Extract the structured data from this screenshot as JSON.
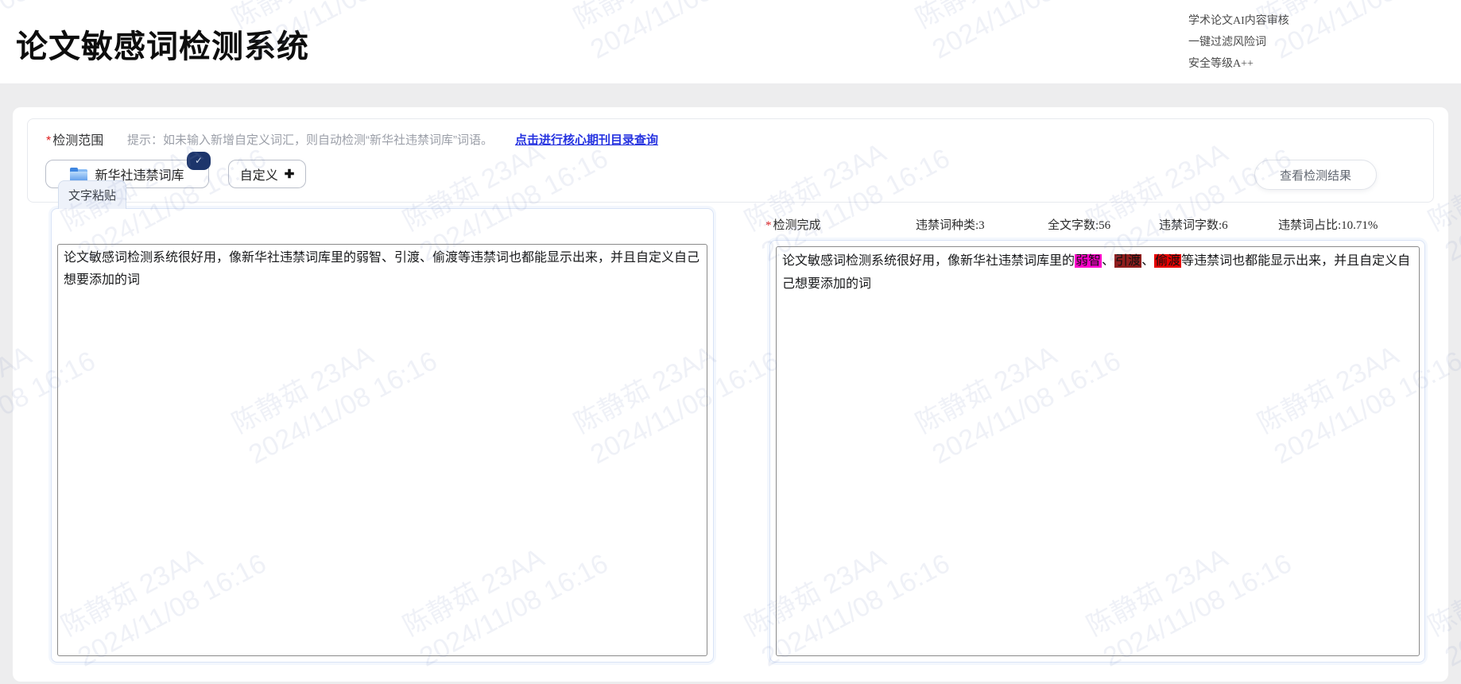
{
  "header": {
    "title": "论文敏感词检测系统",
    "features": [
      "学术论文AI内容审核",
      "一键过滤风险词",
      "安全等级A++"
    ]
  },
  "top_section": {
    "required_mark": "*",
    "scope_label": "检测范围",
    "hint": "提示：如未输入新增自定义词汇，则自动检测“新华社违禁词库”词语。",
    "journal_link": "点击进行核心期刊目录查询",
    "library_button": {
      "label": "新华社违禁词库",
      "icon": "folder-icon",
      "selected_check": "✓"
    },
    "custom_button": {
      "label": "自定义",
      "plus": "✚"
    },
    "view_results_label": "查看检测结果"
  },
  "left_panel": {
    "tab_label": "文字粘贴",
    "input_text": "论文敏感词检测系统很好用，像新华社违禁词库里的弱智、引渡、偷渡等违禁词也都能显示出来，并且自定义自己想要添加的词"
  },
  "right_panel": {
    "required_mark": "*",
    "status_label": "检测完成",
    "stats": [
      "违禁词种类:3",
      "全文字数:56",
      "违禁词字数:6",
      "违禁词占比:10.71%"
    ],
    "result_segments": [
      {
        "text": "论文敏感词检测系统很好用，像新华社违禁词库里的"
      },
      {
        "text": "弱智",
        "highlight": "#ff00cc"
      },
      {
        "text": "、"
      },
      {
        "text": "引渡",
        "highlight": "#8f1d1d"
      },
      {
        "text": "、"
      },
      {
        "text": "偷渡",
        "highlight": "#e60000"
      },
      {
        "text": "等违禁词也都能显示出来，并且自定义自己想要添加的词"
      }
    ]
  },
  "watermark": {
    "line1": "陈静茹 23AA",
    "line2": "2024/11/08 16:16"
  },
  "colors": {
    "link_blue": "#2633e0",
    "required_red": "#e02020",
    "badge_navy": "#1d356b",
    "highlight_magenta": "#ff00cc",
    "highlight_darkred": "#8f1d1d",
    "highlight_red": "#e60000",
    "panel_border_blue": "#d9e3f6"
  }
}
